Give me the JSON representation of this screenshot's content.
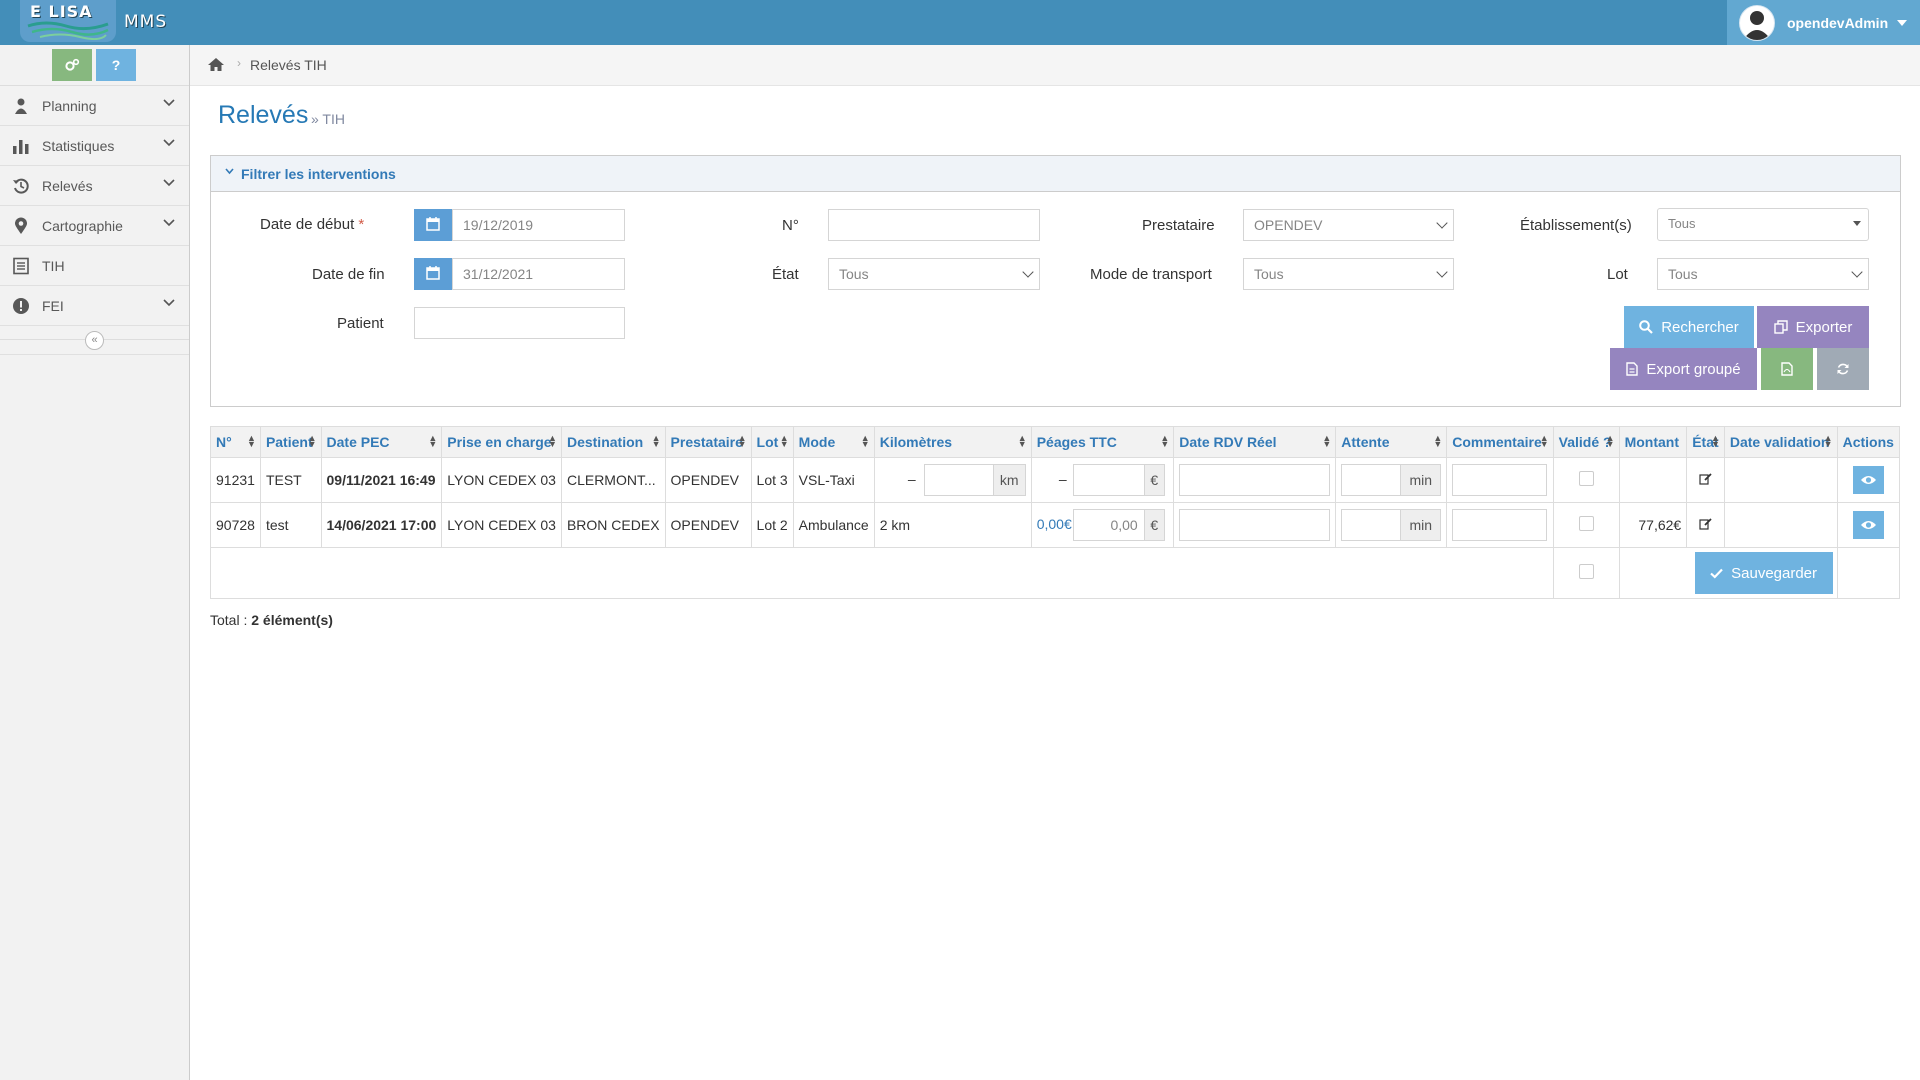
{
  "header": {
    "logo_text": "E LISA",
    "app_name": "MMS",
    "username": "opendevAdmin"
  },
  "shortcuts": {
    "settings_icon": "cogs-icon",
    "help_label": "?"
  },
  "sidebar": {
    "items": [
      {
        "label": "Planning",
        "icon": "user-icon",
        "has_submenu": true
      },
      {
        "label": "Statistiques",
        "icon": "bar-chart-icon",
        "has_submenu": true
      },
      {
        "label": "Relevés",
        "icon": "history-icon",
        "has_submenu": true
      },
      {
        "label": "Cartographie",
        "icon": "map-marker-icon",
        "has_submenu": true
      },
      {
        "label": "TIH",
        "icon": "list-alt-icon",
        "has_submenu": false
      },
      {
        "label": "FEI",
        "icon": "exclamation-circle-icon",
        "has_submenu": true
      }
    ],
    "collapse_label": "«"
  },
  "breadcrumb": {
    "current": "Relevés TIH"
  },
  "page": {
    "title": "Relevés",
    "subtitle": "» TIH"
  },
  "filter": {
    "heading": "Filtrer les interventions",
    "date_debut_label": "Date de début",
    "required_mark": "*",
    "date_debut_value": "19/12/2019",
    "date_fin_label": "Date de fin",
    "date_fin_value": "31/12/2021",
    "patient_label": "Patient",
    "patient_value": "",
    "numero_label": "N°",
    "numero_value": "",
    "etat_label": "État",
    "etat_value": "Tous",
    "prestataire_label": "Prestataire",
    "prestataire_value": "OPENDEV",
    "mode_label": "Mode de transport",
    "mode_value": "Tous",
    "etablissements_label": "Établissement(s)",
    "etablissements_value": "Tous",
    "lot_label": "Lot",
    "lot_value": "Tous",
    "rechercher_label": "Rechercher",
    "exporter_label": "Exporter",
    "export_groupe_label": "Export groupé"
  },
  "table": {
    "columns": [
      "N°",
      "Patient",
      "Date PEC",
      "Prise en charge",
      "Destination",
      "Prestataire",
      "Lot",
      "Mode",
      "Kilomètres",
      "Péages TTC",
      "Date RDV Réel",
      "Attente",
      "Commentaire",
      "Validé ?",
      "Montant",
      "État",
      "Date validation",
      "Actions"
    ],
    "rows": [
      {
        "numero": "91231",
        "patient": "TEST",
        "date_pec": "09/11/2021 16:49",
        "prise_en_charge": "LYON CEDEX 03",
        "destination": "CLERMONT...",
        "prestataire": "OPENDEV",
        "lot": "Lot 3",
        "mode": "VSL-Taxi",
        "km_value": "–",
        "km_input": "",
        "km_unit": "km",
        "peages_value": "–",
        "peages_input": "",
        "peages_unit": "€",
        "rdv": "",
        "attente": "",
        "attente_unit": "min",
        "commentaire": "",
        "montant": ""
      },
      {
        "numero": "90728",
        "patient": "test",
        "date_pec": "14/06/2021 17:00",
        "prise_en_charge": "LYON CEDEX 03",
        "destination": "BRON CEDEX",
        "prestataire": "OPENDEV",
        "lot": "Lot 2",
        "mode": "Ambulance",
        "km_value": "2 km",
        "km_input": "",
        "km_unit": "",
        "peages_value": "0,00€",
        "peages_input": "0,00",
        "peages_unit": "€",
        "rdv": "",
        "attente": "",
        "attente_unit": "min",
        "commentaire": "",
        "montant": "77,62€"
      }
    ],
    "save_label": "Sauvegarder"
  },
  "footer": {
    "total_label": "Total :",
    "total_value": "2 élément(s)"
  },
  "colors": {
    "topbar": "#438eb9",
    "user_box": "#62a8d1",
    "btn_blue": "#6fb3e0",
    "btn_purple": "#9585bf",
    "btn_green": "#87b87f",
    "btn_gray": "#a0aab5",
    "link_blue": "#337ab7",
    "title_blue": "#2679b5",
    "required": "#d15b47"
  }
}
